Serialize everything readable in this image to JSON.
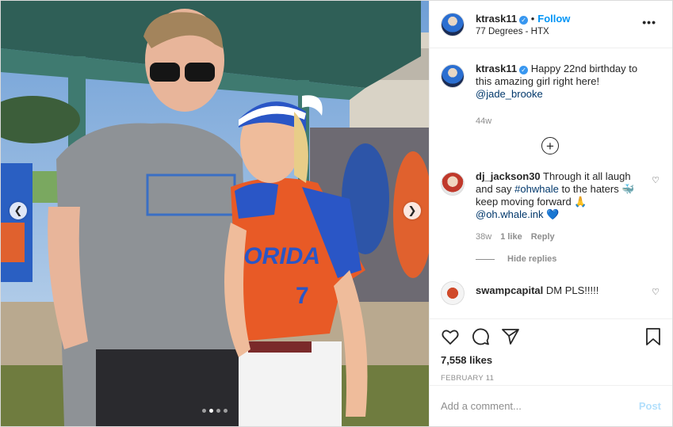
{
  "post": {
    "author": {
      "username": "ktrask11",
      "verified": true,
      "follow_label": "Follow",
      "location": "77 Degrees - HTX"
    },
    "more_icon": "more-horizontal-icon",
    "caption": {
      "username": "ktrask11",
      "text": "Happy 22nd birthday to this amazing girl right here!",
      "mention": "@jade_brooke",
      "time": "44w"
    },
    "load_more_icon": "plus-circle-icon",
    "comments": [
      {
        "username": "dj_jackson30",
        "text_1": "Through it all laugh and say",
        "hashtag": "#ohwhale",
        "text_2": "to the haters 🐳 keep moving forward 🙏",
        "mention": "@oh.whale.ink",
        "emoji_end": "💙",
        "time": "38w",
        "likes": "1 like",
        "reply_label": "Reply"
      },
      {
        "username": "swampcapital",
        "text": "DM PLS!!!!!"
      }
    ],
    "hide_replies_label": "Hide replies",
    "likes_count": "7,558 likes",
    "date": "FEBRUARY 11",
    "comment_placeholder": "Add a comment...",
    "post_button_label": "Post",
    "carousel": {
      "slide_count": 4,
      "active_index": 1
    }
  }
}
